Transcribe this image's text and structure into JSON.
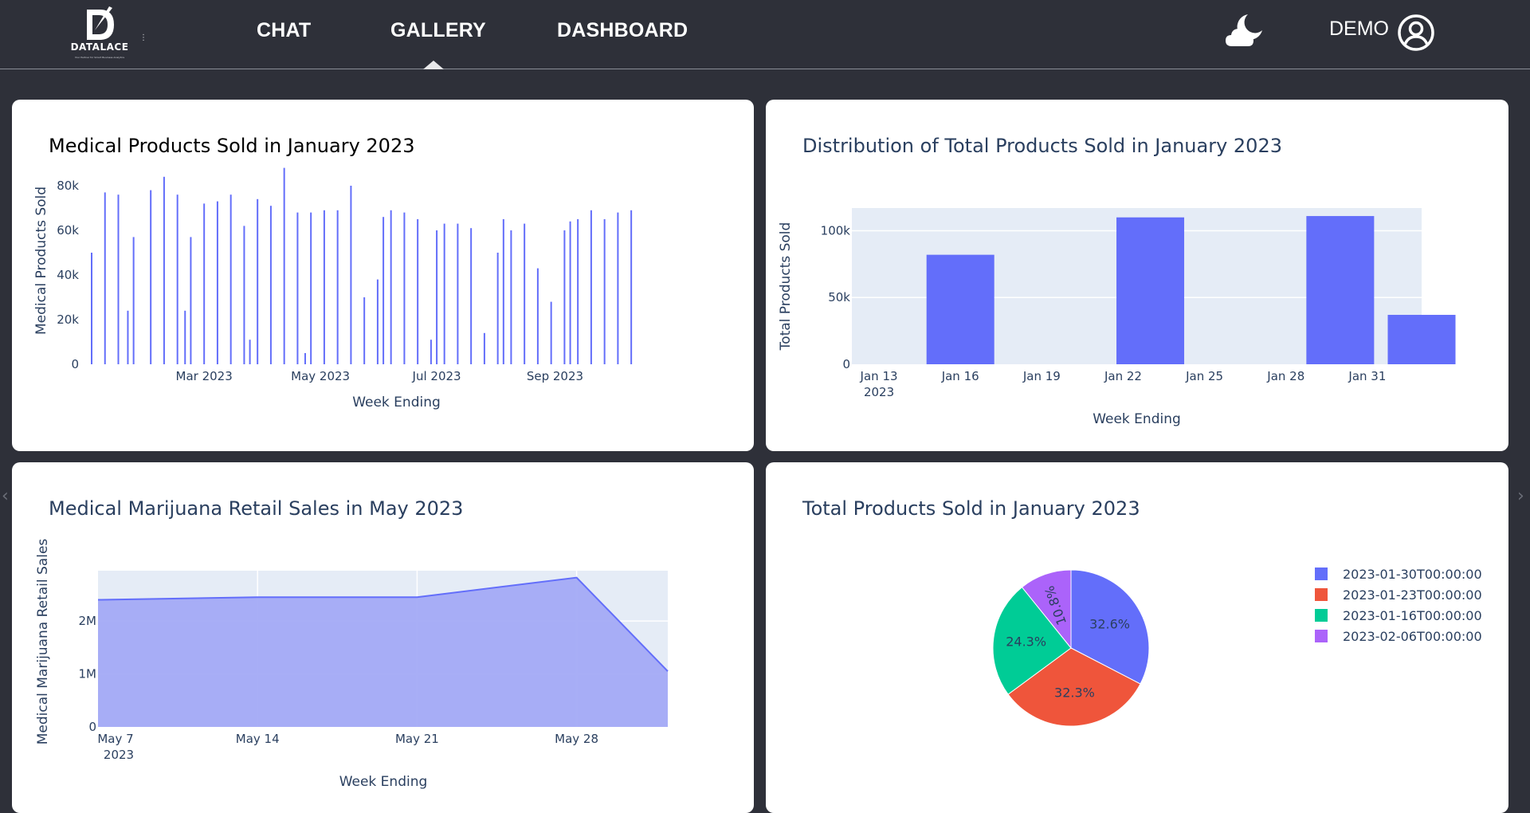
{
  "header": {
    "logo": {
      "letter": "D",
      "name": "DATALACE",
      "tagline": "Your Partner for Smart Business Analytics"
    },
    "nav": [
      {
        "label": "CHAT"
      },
      {
        "label": "GALLERY"
      },
      {
        "label": "DASHBOARD"
      }
    ],
    "active_tab": "GALLERY",
    "theme_icon": "moon-cloud-icon",
    "user": {
      "label": "DEMO",
      "icon": "user-circle-icon"
    }
  },
  "colors": {
    "page_bg": "#2e3039",
    "bar": "#636efa",
    "plot_bg": "#e5ecf6",
    "area_fill": "#a3aaf5",
    "pie": [
      "#636efa",
      "#ef553b",
      "#00cc96",
      "#ab63fa"
    ]
  },
  "charts": [
    {
      "title": "Medical Products Sold in January 2023",
      "xlabel": "Week Ending",
      "ylabel": "Medical Products Sold",
      "yticks": [
        "0",
        "20k",
        "40k",
        "60k",
        "80k"
      ],
      "xticks": [
        "Mar 2023",
        "May 2023",
        "Jul 2023",
        "Sep 2023"
      ]
    },
    {
      "title": "Distribution of Total Products Sold in January 2023",
      "xlabel": "Week Ending",
      "ylabel": "Total Products Sold",
      "yticks": [
        "0",
        "50k",
        "100k"
      ],
      "xticks": [
        "Jan 13",
        "Jan 16",
        "Jan 19",
        "Jan 22",
        "Jan 25",
        "Jan 28",
        "Jan 31"
      ],
      "xtick_year": "2023"
    },
    {
      "title": "Medical Marijuana Retail Sales in May 2023",
      "xlabel": "Week Ending",
      "ylabel": "Medical Marijuana Retail Sales",
      "yticks": [
        "0",
        "1M",
        "2M"
      ],
      "xticks": [
        "May 7",
        "May 14",
        "May 21",
        "May 28"
      ],
      "xtick_year": "2023"
    },
    {
      "title": "Total Products Sold in January 2023",
      "legend": [
        "2023-01-30T00:00:00",
        "2023-01-23T00:00:00",
        "2023-01-16T00:00:00",
        "2023-02-06T00:00:00"
      ]
    }
  ],
  "chart_data": [
    {
      "type": "bar",
      "title": "Medical Products Sold in January 2023",
      "xlabel": "Week Ending",
      "ylabel": "Medical Products Sold",
      "ylim": [
        0,
        90000
      ],
      "x_range": [
        "2023-01-01",
        "2023-10-31"
      ],
      "series": [
        {
          "x": [
            "2023-01-01",
            "2023-01-08",
            "2023-01-15",
            "2023-01-20",
            "2023-01-23",
            "2023-02-01",
            "2023-02-08",
            "2023-02-15",
            "2023-02-19",
            "2023-02-22",
            "2023-03-01",
            "2023-03-08",
            "2023-03-15",
            "2023-03-22",
            "2023-03-25",
            "2023-03-29",
            "2023-04-05",
            "2023-04-12",
            "2023-04-19",
            "2023-04-23",
            "2023-04-26",
            "2023-05-03",
            "2023-05-10",
            "2023-05-17",
            "2023-05-24",
            "2023-05-31",
            "2023-06-03",
            "2023-06-07",
            "2023-06-14",
            "2023-06-21",
            "2023-06-28",
            "2023-07-01",
            "2023-07-05",
            "2023-07-12",
            "2023-07-19",
            "2023-07-26",
            "2023-08-02",
            "2023-08-05",
            "2023-08-09",
            "2023-08-16",
            "2023-08-23",
            "2023-08-30",
            "2023-09-06",
            "2023-09-09",
            "2023-09-13",
            "2023-09-20",
            "2023-09-27",
            "2023-10-04",
            "2023-10-11"
          ],
          "y": [
            50000,
            77000,
            76000,
            24000,
            57000,
            78000,
            84000,
            76000,
            24000,
            57000,
            72000,
            73000,
            76000,
            62000,
            11000,
            74000,
            71000,
            88000,
            68000,
            5000,
            68000,
            69000,
            69000,
            80000,
            30000,
            38000,
            66000,
            69000,
            68000,
            65000,
            11000,
            60000,
            63000,
            63000,
            61000,
            14000,
            50000,
            65000,
            60000,
            63000,
            43000,
            28000,
            60000,
            64000,
            65000,
            69000,
            65000,
            68000,
            69000
          ]
        }
      ]
    },
    {
      "type": "bar",
      "title": "Distribution of Total Products Sold in January 2023",
      "xlabel": "Week Ending",
      "ylabel": "Total Products Sold",
      "ylim": [
        0,
        117000
      ],
      "x_range": [
        "2023-01-12",
        "2023-02-02"
      ],
      "categories": [
        "2023-01-16",
        "2023-01-23",
        "2023-01-30",
        "2023-02-02"
      ],
      "values": [
        82000,
        110000,
        111000,
        37000
      ]
    },
    {
      "type": "area",
      "title": "Medical Marijuana Retail Sales in May 2023",
      "xlabel": "Week Ending",
      "ylabel": "Medical Marijuana Retail Sales",
      "ylim": [
        0,
        2950000
      ],
      "x": [
        "2023-05-07",
        "2023-05-14",
        "2023-05-21",
        "2023-05-28",
        "2023-06-01"
      ],
      "values": [
        2400000,
        2450000,
        2450000,
        2820000,
        1050000
      ]
    },
    {
      "type": "pie",
      "title": "Total Products Sold in January 2023",
      "labels": [
        "2023-01-30T00:00:00",
        "2023-01-23T00:00:00",
        "2023-01-16T00:00:00",
        "2023-02-06T00:00:00"
      ],
      "values": [
        32.6,
        32.3,
        24.3,
        10.8
      ],
      "text": [
        "32.6%",
        "32.3%",
        "24.3%",
        "10.8%"
      ],
      "legend_position": "right"
    }
  ]
}
